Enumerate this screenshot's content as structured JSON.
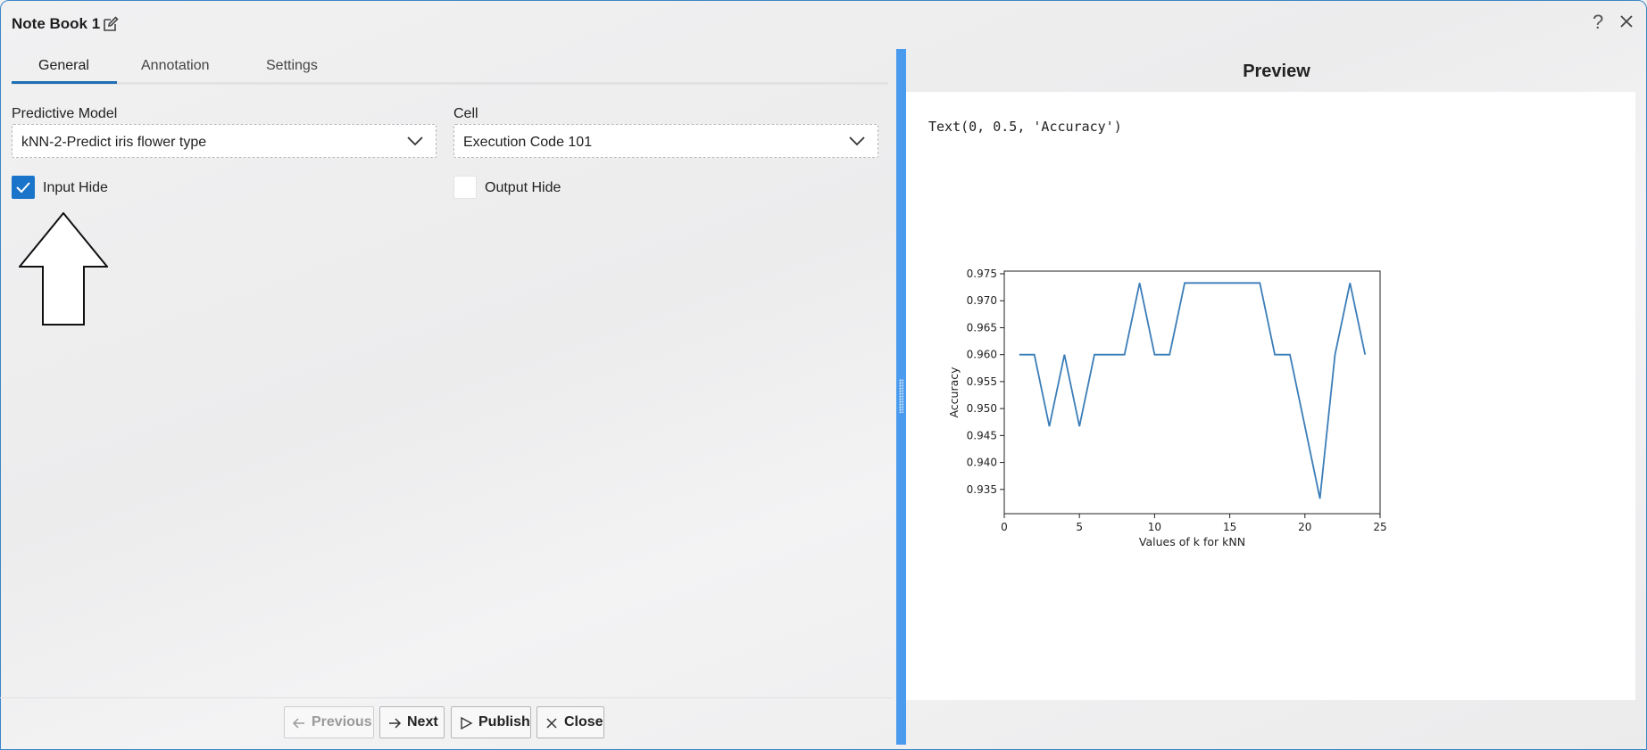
{
  "window": {
    "title": "Note Book 1",
    "help_label": "?"
  },
  "tabs": [
    {
      "label": "General",
      "active": true
    },
    {
      "label": "Annotation",
      "active": false
    },
    {
      "label": "Settings",
      "active": false
    }
  ],
  "form": {
    "model_label": "Predictive Model",
    "model_value": "kNN-2-Predict iris flower type",
    "cell_label": "Cell",
    "cell_value": "Execution Code 101",
    "input_hide_label": "Input Hide",
    "input_hide_checked": true,
    "output_hide_label": "Output Hide",
    "output_hide_checked": false
  },
  "buttons": {
    "previous": "Previous",
    "next": "Next",
    "publish": "Publish",
    "close": "Close"
  },
  "preview": {
    "title": "Preview",
    "code_output": "Text(0, 0.5, 'Accuracy')"
  },
  "colors": {
    "accent": "#1a74c9",
    "splitter": "#4a9bee",
    "line": "#3b7db8"
  },
  "chart_data": {
    "type": "line",
    "title": "",
    "xlabel": "Values of k for kNN",
    "ylabel": "Accuracy",
    "xlim": [
      0,
      25
    ],
    "ylim": [
      0.9305,
      0.9755
    ],
    "xticks": [
      0,
      5,
      10,
      15,
      20,
      25
    ],
    "yticks": [
      0.935,
      0.94,
      0.945,
      0.95,
      0.955,
      0.96,
      0.965,
      0.97,
      0.975
    ],
    "ytick_labels": [
      "0.935",
      "0.940",
      "0.945",
      "0.950",
      "0.955",
      "0.960",
      "0.965",
      "0.970",
      "0.975"
    ],
    "x": [
      1,
      2,
      3,
      4,
      5,
      6,
      7,
      8,
      9,
      10,
      11,
      12,
      13,
      14,
      15,
      16,
      17,
      18,
      19,
      20,
      21,
      22,
      23,
      24
    ],
    "y": [
      0.96,
      0.96,
      0.9467,
      0.96,
      0.9467,
      0.96,
      0.96,
      0.96,
      0.9733,
      0.96,
      0.96,
      0.9733,
      0.9733,
      0.9733,
      0.9733,
      0.9733,
      0.9733,
      0.96,
      0.96,
      0.9467,
      0.9333,
      0.96,
      0.9733,
      0.96
    ],
    "grid": false
  }
}
